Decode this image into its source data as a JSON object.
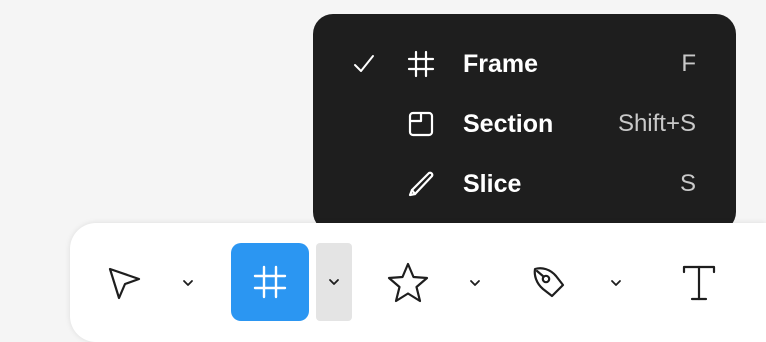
{
  "menu": {
    "items": [
      {
        "label": "Frame",
        "shortcut": "F",
        "icon": "frame-icon",
        "checked": true
      },
      {
        "label": "Section",
        "shortcut": "Shift+S",
        "icon": "section-icon",
        "checked": false
      },
      {
        "label": "Slice",
        "shortcut": "S",
        "icon": "slice-icon",
        "checked": false
      }
    ]
  },
  "toolbar": {
    "tools": [
      {
        "icon": "move-cursor-icon"
      },
      {
        "icon": "frame-icon",
        "active": true
      },
      {
        "icon": "star-icon"
      },
      {
        "icon": "pen-icon"
      },
      {
        "icon": "text-icon"
      }
    ]
  },
  "colors": {
    "menu_bg": "#1e1e1e",
    "active_tool": "#2b96f2",
    "toolbar_bg": "#ffffff",
    "page_bg": "#f5f5f5"
  }
}
